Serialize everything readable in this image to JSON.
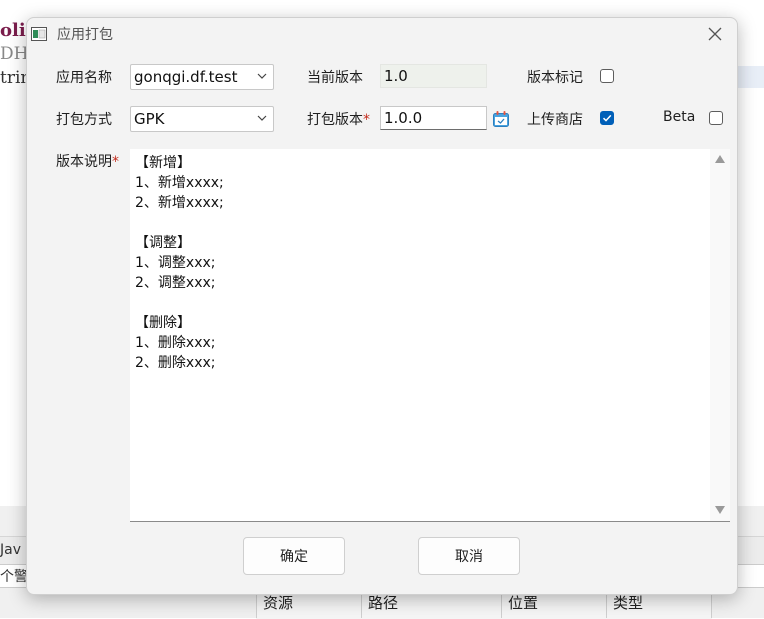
{
  "background": {
    "code_fragments": [
      "olic",
      "DHq",
      "trin"
    ],
    "bottom_panel": {
      "tab_label": "Jav",
      "warning_text": "个警",
      "columns": [
        "资源",
        "路径",
        "位置",
        "类型"
      ]
    }
  },
  "dialog": {
    "title": "应用打包",
    "app_name": {
      "label": "应用名称",
      "value": "gonqgi.df.test"
    },
    "current_version": {
      "label": "当前版本",
      "value": "1.0"
    },
    "version_tag": {
      "label": "版本标记",
      "checked": false
    },
    "pack_mode": {
      "label": "打包方式",
      "value": "GPK"
    },
    "pack_version": {
      "label": "打包版本",
      "required_mark": "*",
      "value": "1.0.0"
    },
    "upload_store": {
      "label": "上传商店",
      "checked": true
    },
    "beta": {
      "label": "Beta",
      "checked": false
    },
    "description": {
      "label": "版本说明",
      "required_mark": "*",
      "lines": [
        "【新增】",
        "1、新增xxxx;",
        "2、新增xxxx;",
        "",
        "【调整】",
        "1、调整xxx;",
        "2、调整xxx;",
        "",
        "【删除】",
        "1、删除xxx;",
        "2、删除xxx;"
      ]
    },
    "buttons": {
      "ok": "确定",
      "cancel": "取消"
    }
  },
  "colors": {
    "accent": "#005fb8",
    "required": "#c42b1c"
  },
  "icons": {
    "app": "window-icon",
    "close": "close-icon",
    "calendar": "calendar-icon",
    "combo_arrow": "chevron-down-icon",
    "scroll_up": "scroll-up-arrow-icon",
    "scroll_down": "scroll-down-arrow-icon"
  }
}
